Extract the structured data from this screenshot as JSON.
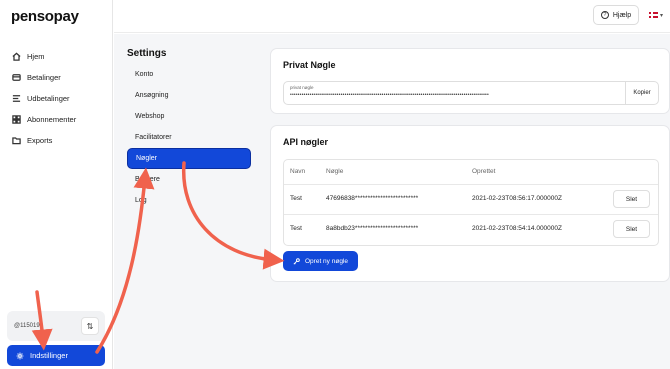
{
  "brand": {
    "logo": "pensopay"
  },
  "sidebar": {
    "items": [
      {
        "label": "Hjem",
        "icon": "home-icon"
      },
      {
        "label": "Betalinger",
        "icon": "card-icon"
      },
      {
        "label": "Udbetalinger",
        "icon": "list-icon"
      },
      {
        "label": "Abonnementer",
        "icon": "grid-icon"
      },
      {
        "label": "Exports",
        "icon": "folder-icon"
      }
    ],
    "account_id": "@115019",
    "settings_label": "Indstillinger"
  },
  "topbar": {
    "help_label": "Hjælp",
    "help_icon_glyph": "?",
    "language_flag": "dk"
  },
  "settings": {
    "title": "Settings",
    "subnav": [
      {
        "label": "Konto",
        "active": false
      },
      {
        "label": "Ansøgning",
        "active": false
      },
      {
        "label": "Webshop",
        "active": false
      },
      {
        "label": "Facilitatorer",
        "active": false
      },
      {
        "label": "Nøgler",
        "active": true
      },
      {
        "label": "Brugere",
        "active": false
      },
      {
        "label": "Log",
        "active": false
      }
    ]
  },
  "private_key": {
    "title": "Privat Nøgle",
    "field_label": "privat nøgle",
    "field_value": "••••••••••••••••••••••••••••••••••••••••••••••••••••••••••••••••••••••••••••••••••••••••••••••••••••••",
    "copy_label": "Kopier"
  },
  "api_keys": {
    "title": "API nøgler",
    "columns": [
      "Navn",
      "Nøgle",
      "Oprettet"
    ],
    "rows": [
      {
        "name": "Test",
        "key": "47696838*************************",
        "created": "2021-02-23T08:56:17.000000Z",
        "action": "Slet"
      },
      {
        "name": "Test",
        "key": "8a8bdb23*************************",
        "created": "2021-02-23T08:54:14.000000Z",
        "action": "Slet"
      }
    ],
    "create_label": "Opret ny nøgle"
  },
  "colors": {
    "accent": "#1248d9",
    "arrow": "#f0624d",
    "background": "#f5f6f8"
  }
}
